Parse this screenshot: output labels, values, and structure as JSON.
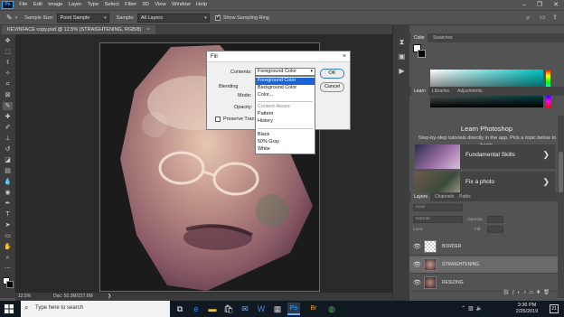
{
  "app": {
    "logo": "Ps"
  },
  "menu": [
    "File",
    "Edit",
    "Image",
    "Layer",
    "Type",
    "Select",
    "Filter",
    "3D",
    "View",
    "Window",
    "Help"
  ],
  "options_bar": {
    "sample_size_label": "Sample Size:",
    "sample_size_value": "Point Sample",
    "sample_label": "Sample:",
    "sample_value": "All Layers",
    "show_ring_label": "Show Sampling Ring"
  },
  "document": {
    "tab_title": "KEVINFACE copy.psd @ 12.5% (STRAIGHTENING, RGB/8)",
    "tab_close": "×",
    "zoom": "12.5%",
    "doc_size": "Doc: 50.3M/227.6M"
  },
  "fill_dialog": {
    "title": "Fill",
    "close": "×",
    "contents_label": "Contents:",
    "contents_value": "Foreground Color",
    "blending_label": "Blending",
    "mode_label": "Mode:",
    "opacity_label": "Opacity:",
    "preserve_label": "Preserve Tran",
    "ok_label": "OK",
    "cancel_label": "Cancel",
    "options": [
      {
        "label": "Foreground Color",
        "state": "selected"
      },
      {
        "label": "Background Color",
        "state": "normal"
      },
      {
        "label": "Color...",
        "state": "normal"
      },
      {
        "label": "Content-Aware",
        "state": "disabled"
      },
      {
        "label": "Pattern",
        "state": "normal"
      },
      {
        "label": "History",
        "state": "normal"
      },
      {
        "label": "Black",
        "state": "normal"
      },
      {
        "label": "50% Gray",
        "state": "normal"
      },
      {
        "label": "White",
        "state": "normal"
      }
    ]
  },
  "color_panel": {
    "tabs": [
      "Color",
      "Swatches"
    ]
  },
  "learn_panel": {
    "tabs": [
      "Learn",
      "Libraries",
      "Adjustments"
    ],
    "heading": "Learn Photoshop",
    "description": "Step-by-step tutorials directly in the app. Pick a topic below to begin.",
    "cards": [
      {
        "title": "Fundamental Skills",
        "arrow": "❯"
      },
      {
        "title": "Fix a photo",
        "arrow": "❯"
      }
    ]
  },
  "layers_panel": {
    "tabs": [
      "Layers",
      "Channels",
      "Paths"
    ],
    "kind_placeholder": "Kind",
    "blend_mode": "Normal",
    "opacity_label": "Opacity:",
    "lock_label": "Lock:",
    "fill_label": "Fill:",
    "layers": [
      {
        "name": "BORDER",
        "selected": false
      },
      {
        "name": "STRAIGHTENING",
        "selected": true
      },
      {
        "name": "RESIZING",
        "selected": false
      }
    ]
  },
  "taskbar": {
    "search_placeholder": "Type here to search",
    "time": "3:36 PM",
    "date": "2/25/2019",
    "notifications": "21"
  },
  "colors": {
    "ps_blue": "#31a8ff",
    "ui_dark": "#535353",
    "selection_blue": "#1a64d6"
  }
}
